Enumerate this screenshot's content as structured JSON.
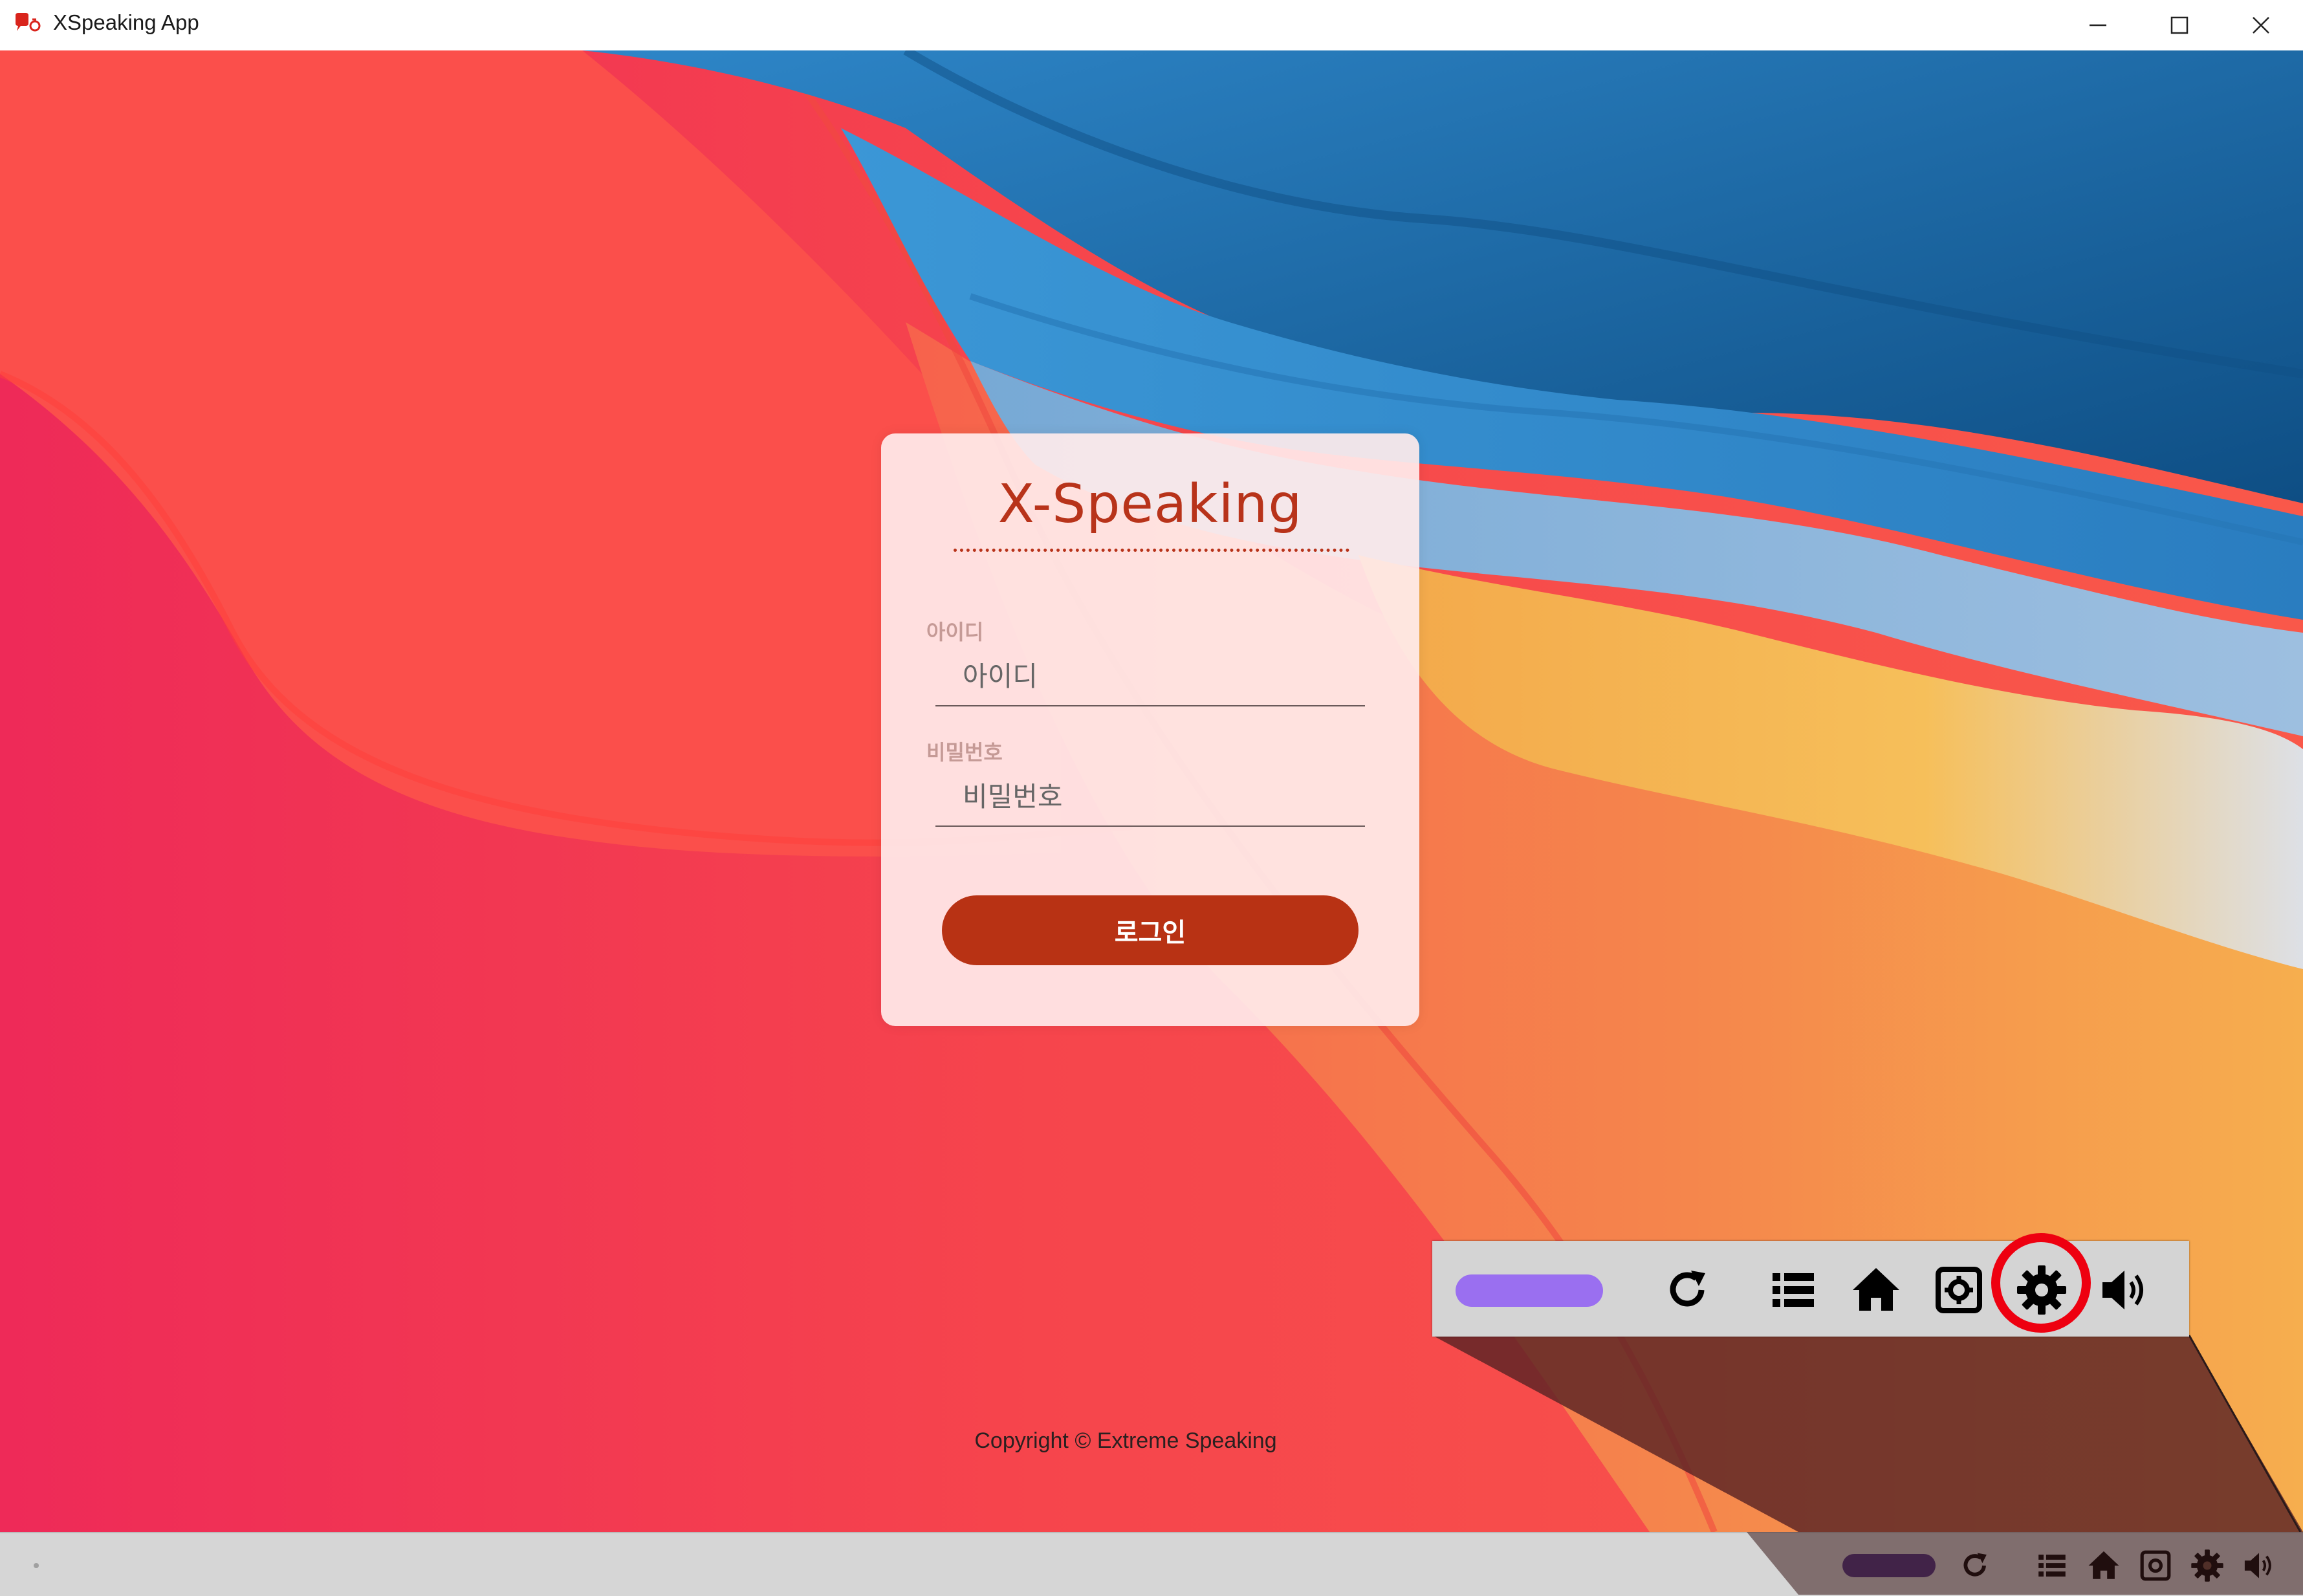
{
  "window": {
    "title": "XSpeaking App",
    "icon": "app-logo-icon",
    "controls": [
      "minimize-icon",
      "maximize-icon",
      "close-icon"
    ]
  },
  "login": {
    "logo_text": "X-Speaking",
    "id_label": "아이디",
    "id_placeholder": "아이디",
    "password_label": "비밀번호",
    "password_placeholder": "비밀번호",
    "login_button": "로그인"
  },
  "footer": {
    "copyright": "Copyright © Extreme Speaking"
  },
  "toolbar": {
    "icons": [
      "refresh-icon",
      "list-icon",
      "home-icon",
      "screenshot-icon",
      "gear-icon",
      "volume-icon"
    ],
    "highlighted": "gear-icon",
    "highlight_color": "#ee0010",
    "pill_color": "#9a6ff0"
  },
  "bottom_bar": {
    "icons": [
      "refresh-icon",
      "list-icon",
      "home-icon",
      "screenshot-icon",
      "gear-icon",
      "volume-icon"
    ],
    "pill_color": "#4a2f80"
  },
  "colors": {
    "brand": "#b8331a",
    "button": "#b83214"
  }
}
